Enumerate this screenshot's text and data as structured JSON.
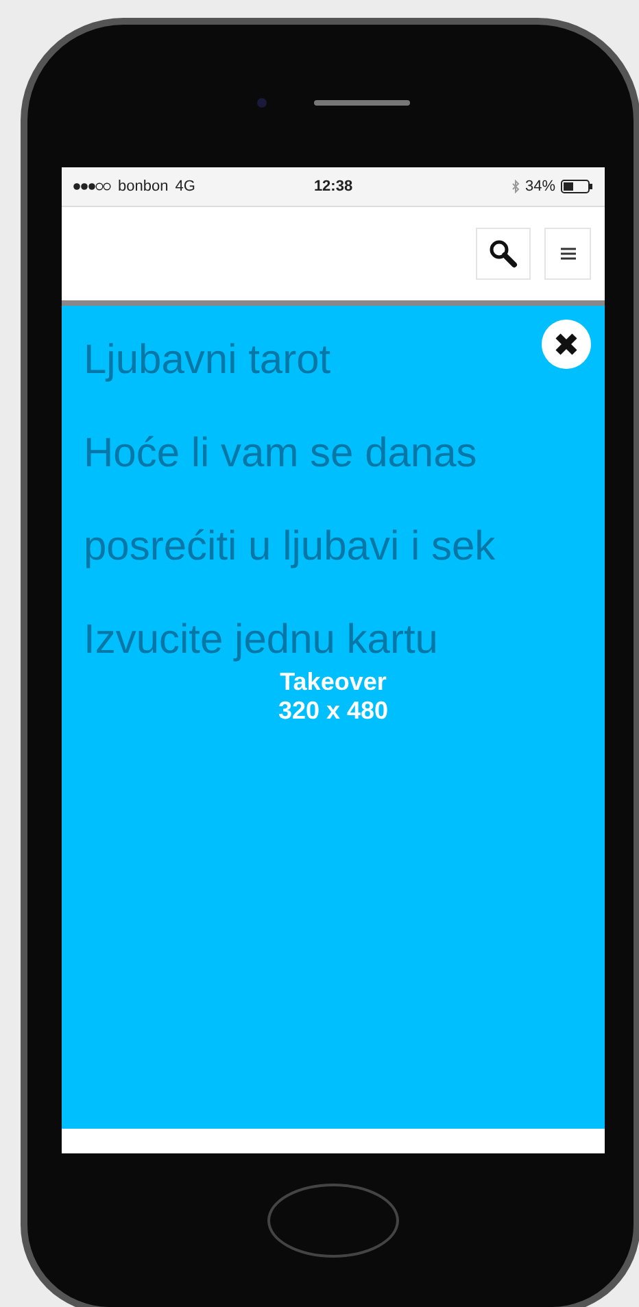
{
  "status_bar": {
    "carrier": "bonbon",
    "network": "4G",
    "time": "12:38",
    "battery": "34%"
  },
  "background_text": [
    "Ljubavni tarot",
    "Hoće li vam se danas",
    "posrećiti u ljubavi i sek",
    "Izvucite jednu kartu"
  ],
  "ad": {
    "title": "Takeover",
    "size": "320 x 480"
  }
}
